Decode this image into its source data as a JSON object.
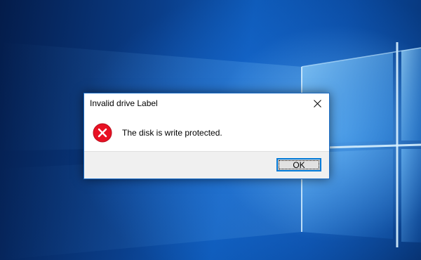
{
  "desktop": {
    "wallpaper": "windows-10-hero-wallpaper",
    "colors": {
      "background_dark": "#041c4a",
      "background_mid": "#0e5ab8",
      "light_glow": "#8fd4ff"
    }
  },
  "dialog": {
    "title": "Invalid drive Label",
    "message": "The disk is write protected.",
    "icon": "error-icon",
    "close_icon": "close-icon",
    "ok_label": "OK",
    "colors": {
      "border": "#1e6fc7",
      "error_red": "#e81123",
      "footer_bg": "#f0f0f0",
      "button_focus": "#0078d7"
    }
  }
}
